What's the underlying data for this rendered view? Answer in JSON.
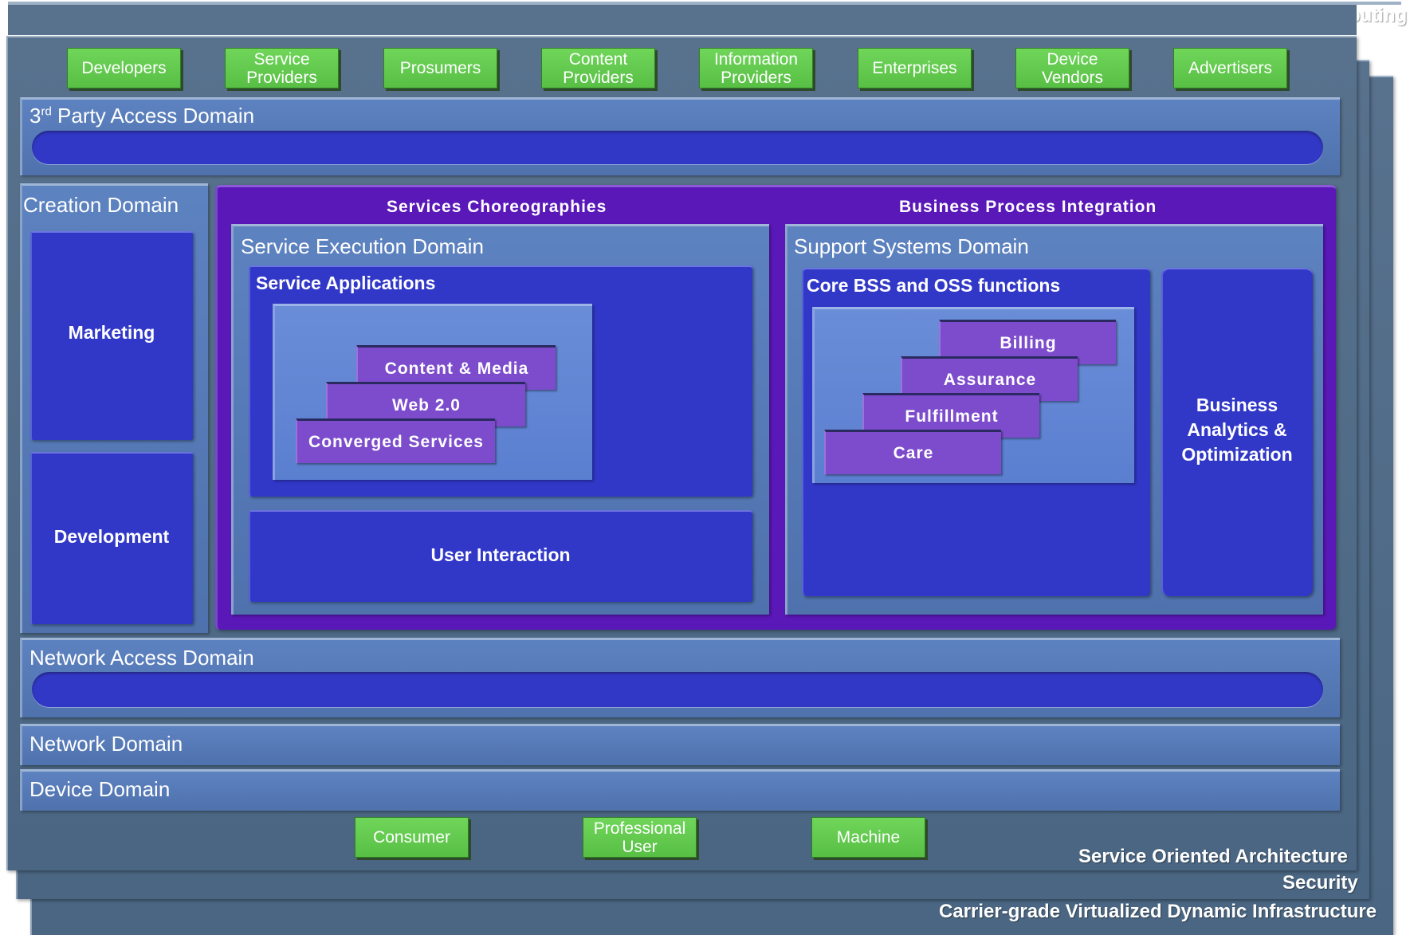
{
  "layers": {
    "cloud": "Cloud Computing",
    "soa": "Service Oriented Architecture",
    "security": "Security",
    "infrastructure": "Carrier-grade Virtualized Dynamic Infrastructure"
  },
  "actors": [
    "Developers",
    "Service\nProviders",
    "Prosumers",
    "Content\nProviders",
    "Information\nProviders",
    "Enterprises",
    "Device\nVendors",
    "Advertisers"
  ],
  "third_party": {
    "base": "3",
    "sup": "rd",
    "rest": " Party Access Domain"
  },
  "creation": {
    "title": "Creation Domain",
    "marketing": "Marketing",
    "development": "Development"
  },
  "core": {
    "choreographies": "Services Choreographies",
    "bpi": "Business Process Integration",
    "execution": {
      "title": "Service Execution Domain",
      "apps_title": "Service Applications",
      "apps": [
        "Content & Media",
        "Web 2.0",
        "Converged Services"
      ],
      "user_interaction": "User Interaction"
    },
    "support": {
      "title": "Support Systems Domain",
      "bss_title": "Core BSS and OSS functions",
      "functions": [
        "Billing",
        "Assurance",
        "Fulfillment",
        "Care"
      ],
      "analytics": "Business\nAnalytics &\nOptimization"
    }
  },
  "network_access": "Network Access Domain",
  "network": "Network Domain",
  "device": "Device Domain",
  "users": [
    "Consumer",
    "Professional\nUser",
    "Machine"
  ],
  "colors": {
    "layer": "#58728e",
    "actor_green": "#63ca4f",
    "bar_blue": "#5d82c0",
    "dark_blue": "#3138c8",
    "purple_panel": "#5a18b8",
    "stair_purple": "#7c4ccc"
  }
}
